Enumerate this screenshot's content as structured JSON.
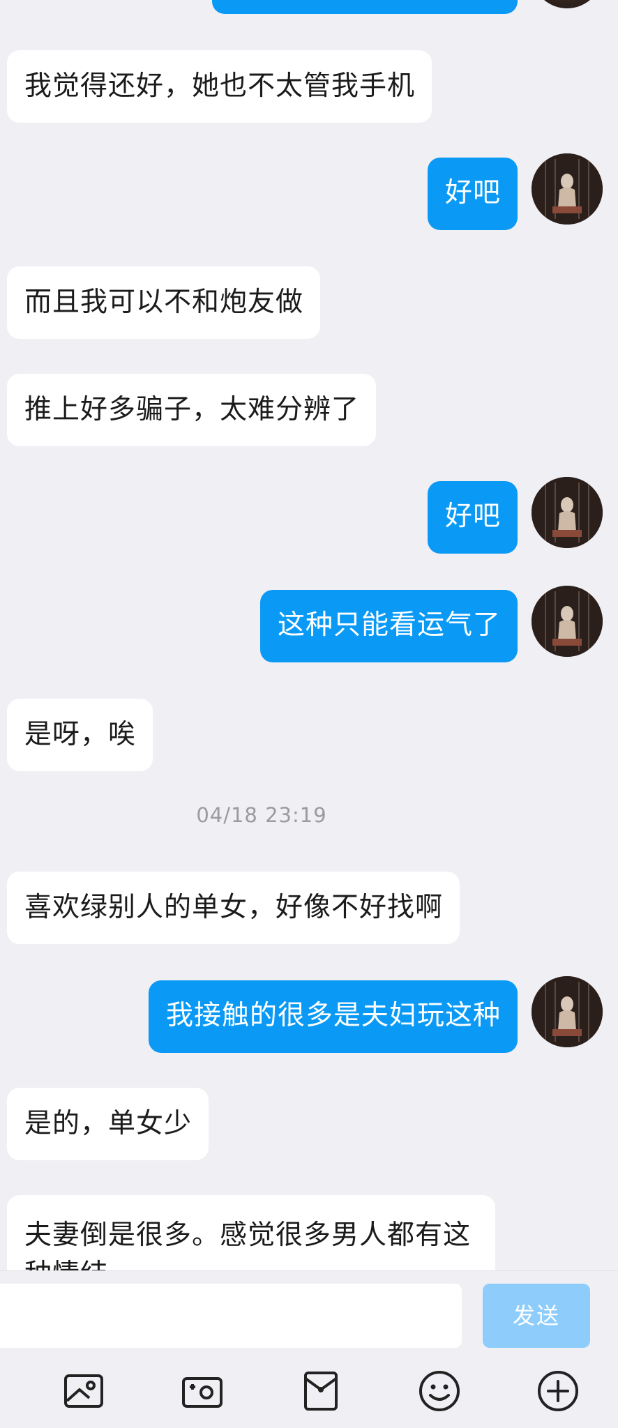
{
  "messages": [
    {
      "side": "in",
      "text": "我觉得还好，她也不太管我手机"
    },
    {
      "side": "out",
      "text": "好吧"
    },
    {
      "side": "in",
      "text": "而且我可以不和炮友做"
    },
    {
      "side": "in",
      "text": "推上好多骗子，太难分辨了"
    },
    {
      "side": "out",
      "text": "好吧"
    },
    {
      "side": "out",
      "text": "这种只能看运气了"
    },
    {
      "side": "in",
      "text": "是呀，唉"
    },
    {
      "side": "in",
      "text": "喜欢绿别人的单女，好像不好找啊"
    },
    {
      "side": "out",
      "text": "我接触的很多是夫妇玩这种"
    },
    {
      "side": "in",
      "text": "是的，单女少"
    },
    {
      "side": "in",
      "text": "夫妻倒是很多。感觉很多男人都有这种情结"
    }
  ],
  "timestamp": "04/18 23:19",
  "input": {
    "value": "",
    "placeholder": ""
  },
  "send_label": "发送",
  "toolbar_icons": [
    "image-icon",
    "camera-icon",
    "red-packet-icon",
    "emoji-icon",
    "plus-icon"
  ],
  "colors": {
    "background": "#f0eff4",
    "outgoing_bubble": "#0a9af5",
    "incoming_bubble": "#ffffff",
    "send_button_disabled": "#8ecdfb"
  }
}
